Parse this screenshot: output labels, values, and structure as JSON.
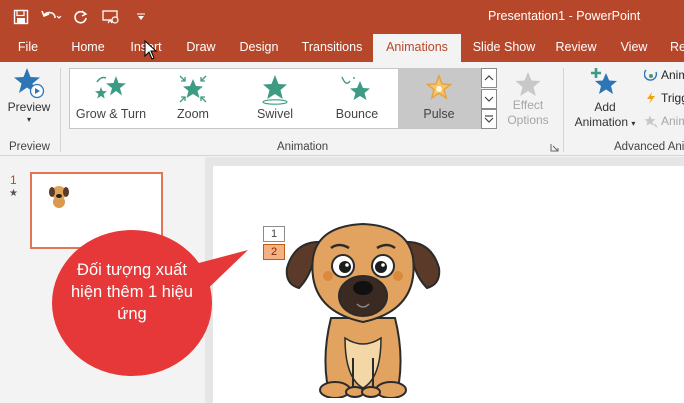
{
  "window": {
    "title": "Presentation1 - PowerPoint"
  },
  "tabs": [
    "File",
    "Home",
    "Insert",
    "Draw",
    "Design",
    "Transitions",
    "Animations",
    "Slide Show",
    "Review",
    "View",
    "Re"
  ],
  "preview": {
    "label": "Preview",
    "group_label": "Preview"
  },
  "gallery": {
    "items": [
      "Grow & Turn",
      "Zoom",
      "Swivel",
      "Bounce",
      "Pulse"
    ],
    "selected": "Pulse"
  },
  "effect_options": {
    "line1": "Effect",
    "line2": "Options"
  },
  "animation_group_label": "Animation",
  "add_animation": {
    "line1": "Add",
    "line2": "Animation"
  },
  "advanced": {
    "group_label": "Advanced Ani",
    "items": [
      "Anim",
      "Trigg",
      "Anim"
    ]
  },
  "slides": {
    "number": "1",
    "star": "★"
  },
  "animation_tags": [
    "1",
    "2"
  ],
  "callout": {
    "text": "Đối tượng xuất hiện thêm 1 hiệu ứng"
  },
  "colors": {
    "accent": "#b7472a",
    "callout": "#e63838",
    "selected_tag": "#f4b183"
  }
}
